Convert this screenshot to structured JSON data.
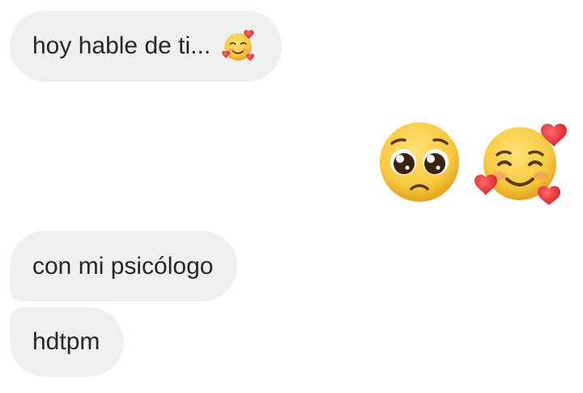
{
  "messages": [
    {
      "sender": "them",
      "text": "hoy hable de ti...",
      "emoji": "smiling-face-with-hearts-icon"
    },
    {
      "sender": "me",
      "emojis": [
        "pleading-face-icon",
        "smiling-face-with-hearts-icon"
      ]
    },
    {
      "sender": "them",
      "text": "con mi psicólogo"
    },
    {
      "sender": "them",
      "text": "hdtpm"
    }
  ],
  "colors": {
    "page_background": "#ffffff",
    "received_bubble": "#efefef",
    "message_text": "#262626",
    "emoji_face": "#f7c940",
    "heart": "#e8262f"
  }
}
